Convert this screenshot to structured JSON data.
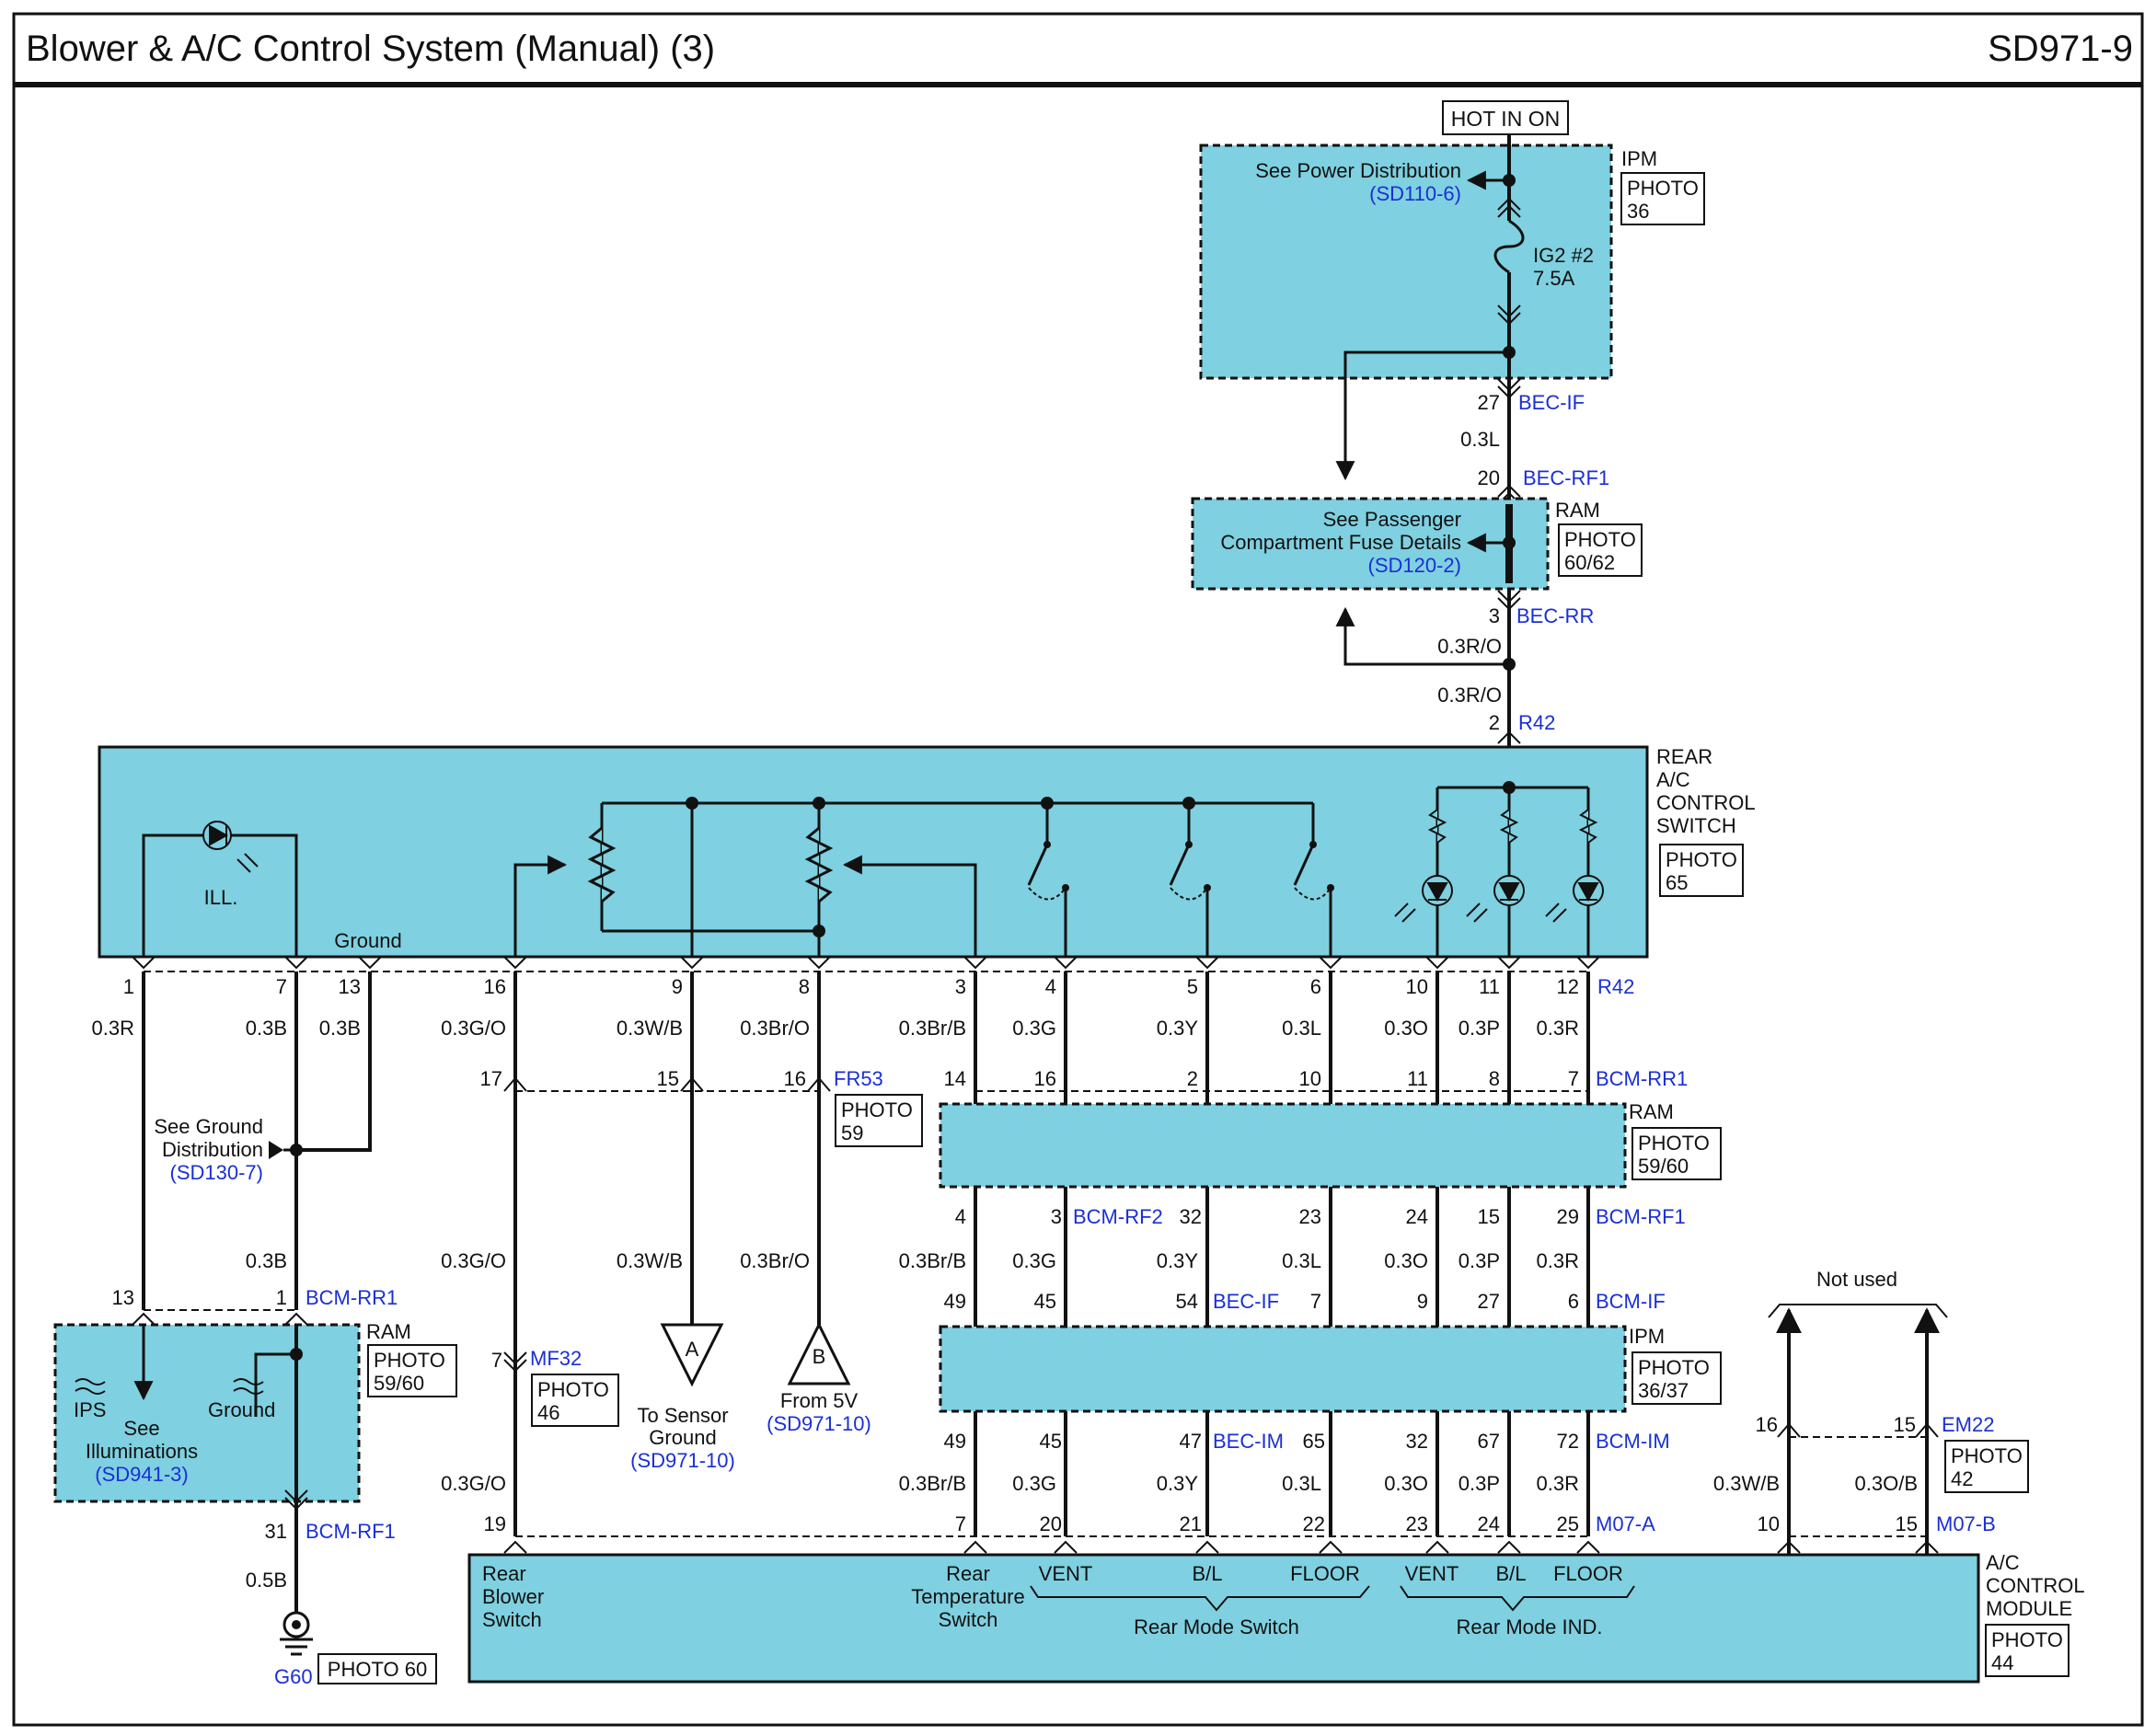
{
  "header": {
    "title": "Blower & A/C Control System (Manual) (3)",
    "code": "SD971-9"
  },
  "colors": {
    "module_fill": "#7fd0e0",
    "link_blue": "#1a2fd6",
    "wire": "#111111"
  },
  "top": {
    "hot_label": "HOT IN ON",
    "ipm": {
      "name": "IPM",
      "photo_a": "PHOTO",
      "photo_b": "36",
      "see": "See Power Distribution",
      "ref": "(SD110-6)",
      "fuse_a": "IG2 #2",
      "fuse_b": "7.5A"
    },
    "pin27": "27",
    "bec_if": "BEC-IF",
    "wire_03l": "0.3L",
    "pin20": "20",
    "bec_rf1": "BEC-RF1",
    "ram": {
      "name": "RAM",
      "photo_a": "PHOTO",
      "photo_b": "60/62",
      "see_a": "See Passenger",
      "see_b": "Compartment Fuse Details",
      "ref": "(SD120-2)"
    },
    "pin3": "3",
    "bec_rr": "BEC-RR",
    "wire_ro_a": "0.3R/O",
    "wire_ro_b": "0.3R/O",
    "pin2": "2",
    "r42": "R42"
  },
  "rear_switch": {
    "name_1": "REAR",
    "name_2": "A/C",
    "name_3": "CONTROL",
    "name_4": "SWITCH",
    "photo_a": "PHOTO",
    "photo_b": "65",
    "ill": "ILL.",
    "ground": "Ground",
    "conn": "R42",
    "pins": [
      "1",
      "7",
      "13",
      "16",
      "9",
      "8",
      "3",
      "4",
      "5",
      "6",
      "10",
      "11",
      "12"
    ]
  },
  "wires_top": [
    "0.3R",
    "0.3B",
    "0.3B",
    "0.3G/O",
    "0.3W/B",
    "0.3Br/O",
    "0.3Br/B",
    "0.3G",
    "0.3Y",
    "0.3L",
    "0.3O",
    "0.3P",
    "0.3R"
  ],
  "left_side": {
    "see_a": "See Ground",
    "see_b": "Distribution",
    "ref": "(SD130-7)",
    "wire_b": "0.3B",
    "pin13": "13",
    "pin1": "1",
    "bcm_rr1": "BCM-RR1",
    "ram": {
      "name": "RAM",
      "photo_a": "PHOTO",
      "photo_b": "59/60",
      "ips": "IPS",
      "ground": "Ground",
      "see_a": "See",
      "see_b": "Illuminations",
      "ref": "(SD941-3)"
    },
    "pin31": "31",
    "bcm_rf1": "BCM-RF1",
    "wire_05b": "0.5B",
    "g60": "G60",
    "photo60": "PHOTO 60"
  },
  "mid": {
    "pin17": "17",
    "pin15": "15",
    "pin16": "16",
    "fr53": "FR53",
    "photo_a": "PHOTO",
    "photo_b": "59",
    "wire_go": "0.3G/O",
    "wire_wb": "0.3W/B",
    "wire_bro": "0.3Br/O",
    "pin7": "7",
    "mf32": "MF32",
    "mf_photo_a": "PHOTO",
    "mf_photo_b": "46",
    "wire_go2": "0.3G/O",
    "pin19": "19",
    "tri_a": "A",
    "tri_a_1": "To Sensor",
    "tri_a_2": "Ground",
    "tri_a_ref": "(SD971-10)",
    "tri_b": "B",
    "tri_b_1": "From 5V",
    "tri_b_ref": "(SD971-10)"
  },
  "bus": {
    "r1_pins": [
      "14",
      "16",
      "2",
      "10",
      "11",
      "8",
      "7"
    ],
    "bcm_rr1": "BCM-RR1",
    "ram": {
      "name": "RAM",
      "photo_a": "PHOTO",
      "photo_b": "59/60"
    },
    "r2_pins": [
      "4",
      "3",
      "32",
      "23",
      "24",
      "15",
      "29"
    ],
    "bcm_rf2": "BCM-RF2",
    "bcm_rf1": "BCM-RF1",
    "wires_1": [
      "0.3Br/B",
      "0.3G",
      "0.3Y",
      "0.3L",
      "0.3O",
      "0.3P",
      "0.3R"
    ],
    "r3_pins": [
      "49",
      "45",
      "54",
      "7",
      "9",
      "27",
      "6"
    ],
    "bec_if": "BEC-IF",
    "bcm_if": "BCM-IF",
    "ipm": {
      "name": "IPM",
      "photo_a": "PHOTO",
      "photo_b": "36/37"
    },
    "r4_pins": [
      "49",
      "45",
      "47",
      "65",
      "32",
      "67",
      "72"
    ],
    "bec_im": "BEC-IM",
    "bcm_im": "BCM-IM",
    "wires_2": [
      "0.3Br/B",
      "0.3G",
      "0.3Y",
      "0.3L",
      "0.3O",
      "0.3P",
      "0.3R"
    ],
    "r5_pins": [
      "7",
      "20",
      "21",
      "22",
      "23",
      "24",
      "25"
    ],
    "m07a": "M07-A"
  },
  "right": {
    "not_used": "Not used",
    "pin16": "16",
    "pin15": "15",
    "em22": "EM22",
    "photo_a": "PHOTO",
    "photo_b": "42",
    "wire_wb": "0.3W/B",
    "wire_ob": "0.3O/B",
    "pin10": "10",
    "pin15b": "15",
    "m07b": "M07-B"
  },
  "acm": {
    "name_1": "A/C",
    "name_2": "CONTROL",
    "name_3": "MODULE",
    "photo_a": "PHOTO",
    "photo_b": "44",
    "rbs_1": "Rear",
    "rbs_2": "Blower",
    "rbs_3": "Switch",
    "rts_1": "Rear",
    "rts_2": "Temperature",
    "rts_3": "Switch",
    "vent": "VENT",
    "bl": "B/L",
    "floor": "FLOOR",
    "vent2": "VENT",
    "bl2": "B/L",
    "floor2": "FLOOR",
    "rms": "Rear Mode Switch",
    "rmi": "Rear Mode IND."
  }
}
